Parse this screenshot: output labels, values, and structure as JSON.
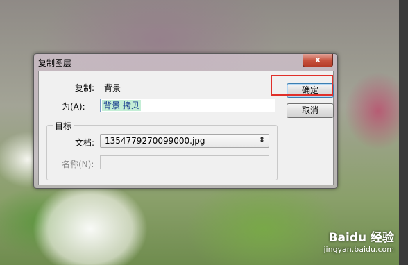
{
  "dialog": {
    "title": "复制图层",
    "close_glyph": "x",
    "copy_label": "复制:",
    "copy_value": "背景",
    "as_label": "为(A):",
    "as_value": "背景 拷贝",
    "ok_label": "确定",
    "cancel_label": "取消",
    "target_group": {
      "title": "目标",
      "document_label": "文档:",
      "document_value": "1354779270099000.jpg",
      "name_label": "名称(N):",
      "name_value": ""
    }
  },
  "watermark": {
    "logo": "Baidu 经验",
    "url": "jingyan.baidu.com"
  },
  "colors": {
    "highlight": "#e0302a",
    "close_button": "#c8533f"
  }
}
